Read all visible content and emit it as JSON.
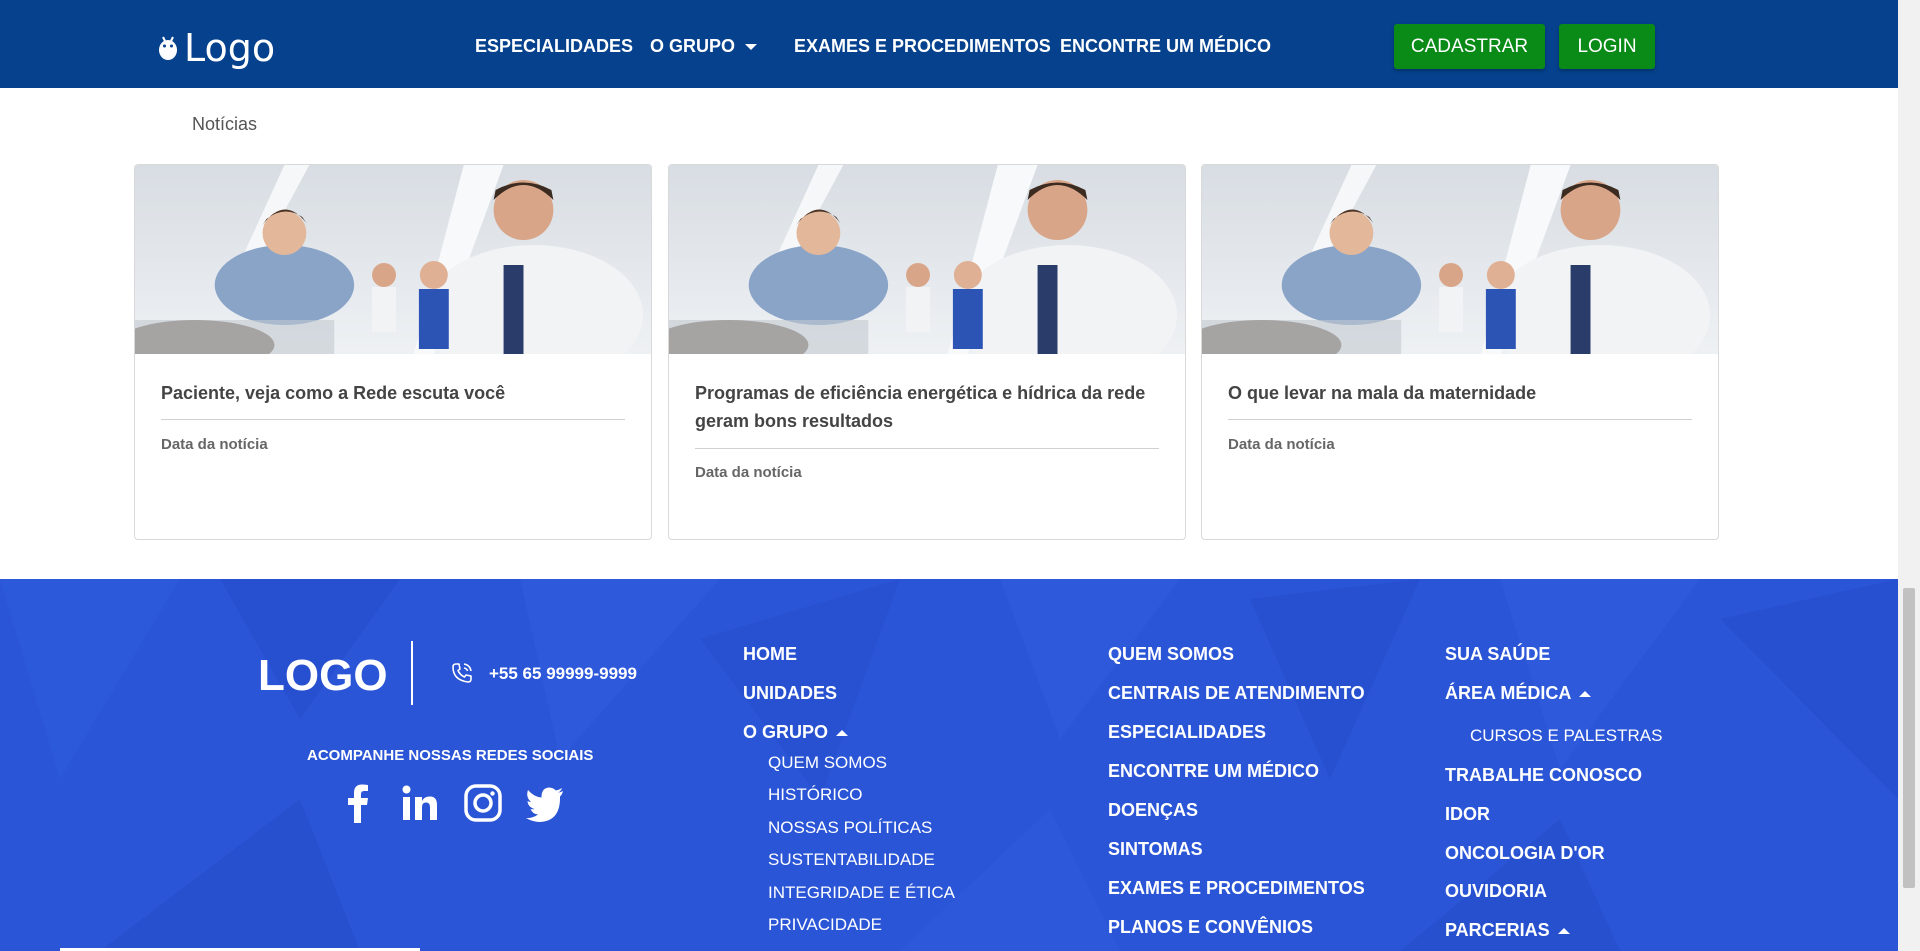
{
  "header": {
    "logo_text": "Logo",
    "nav": [
      "ESPECIALIDADES",
      "O GRUPO",
      "EXAMES E PROCEDIMENTOS",
      "ENCONTRE UM MÉDICO"
    ],
    "register_label": "CADASTRAR",
    "login_label": "LOGIN"
  },
  "breadcrumb": "Notícias",
  "news": [
    {
      "title": "Paciente, veja como a Rede escuta você",
      "date": "Data da notícia"
    },
    {
      "title": "Programas de eficiência energética e hídrica da rede geram bons resultados",
      "date": "Data da notícia"
    },
    {
      "title": "O que levar na mala da maternidade",
      "date": "Data da notícia"
    }
  ],
  "footer": {
    "logo": "LOGO",
    "phone": "+55 65 99999-9999",
    "social_title": "ACOMPANHE NOSSAS REDES SOCIAIS",
    "social_icons": [
      "facebook-icon",
      "linkedin-icon",
      "instagram-icon",
      "twitter-icon"
    ],
    "col1": {
      "links": [
        "HOME",
        "UNIDADES",
        "O GRUPO"
      ],
      "sub": [
        "QUEM SOMOS",
        "HISTÓRICO",
        "NOSSAS POLÍTICAS",
        "SUSTENTABILIDADE",
        "INTEGRIDADE E ÉTICA",
        "PRIVACIDADE"
      ]
    },
    "col2": [
      "QUEM SOMOS",
      "CENTRAIS DE ATENDIMENTO",
      "ESPECIALIDADES",
      "ENCONTRE UM MÉDICO",
      "DOENÇAS",
      "SINTOMAS",
      "EXAMES E PROCEDIMENTOS",
      "PLANOS E CONVÊNIOS"
    ],
    "col3": {
      "links": [
        "SUA SAÚDE",
        "ÁREA MÉDICA",
        "TRABALHE CONOSCO",
        "IDOR",
        "ONCOLOGIA D'OR",
        "OUVIDORIA",
        "PARCERIAS"
      ],
      "sub": [
        "CURSOS E PALESTRAS"
      ]
    }
  },
  "colors": {
    "header": "#05418c",
    "button": "#0a8a17",
    "footer": "#2a55d6"
  }
}
